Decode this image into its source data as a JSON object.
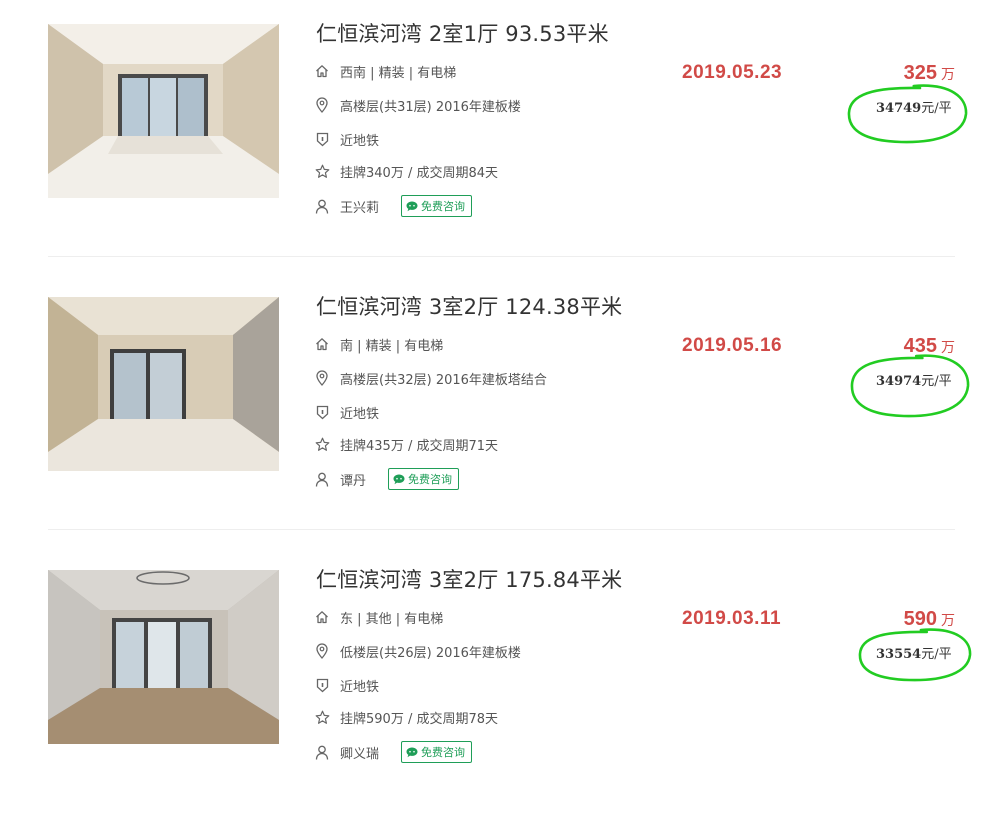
{
  "listings": [
    {
      "title": "仁恒滨河湾 2室1厅 93.53平米",
      "house_info": "西南 | 精装 | 有电梯",
      "position_info": "高楼层(共31层) 2016年建板楼",
      "tag": "近地铁",
      "deal_info": "挂牌340万 / 成交周期84天",
      "agent": "王兴莉",
      "consult_label": "免费咨询",
      "deal_date": "2019.05.23",
      "total_price": "325",
      "price_unit": "万",
      "unit_price": "34749",
      "unit_price_suffix": "元/平"
    },
    {
      "title": "仁恒滨河湾 3室2厅 124.38平米",
      "house_info": "南 | 精装 | 有电梯",
      "position_info": "高楼层(共32层) 2016年建板塔结合",
      "tag": "近地铁",
      "deal_info": "挂牌435万 / 成交周期71天",
      "agent": "谭丹",
      "consult_label": "免费咨询",
      "deal_date": "2019.05.16",
      "total_price": "435",
      "price_unit": "万",
      "unit_price": "34974",
      "unit_price_suffix": "元/平"
    },
    {
      "title": "仁恒滨河湾 3室2厅 175.84平米",
      "house_info": "东 | 其他 | 有电梯",
      "position_info": "低楼层(共26层) 2016年建板楼",
      "tag": "近地铁",
      "deal_info": "挂牌590万 / 成交周期78天",
      "agent": "卿义瑞",
      "consult_label": "免费咨询",
      "deal_date": "2019.03.11",
      "total_price": "590",
      "price_unit": "万",
      "unit_price": "33554",
      "unit_price_suffix": "元/平"
    }
  ],
  "icons": {
    "house_info": "house-icon",
    "position_info": "location-pin-icon",
    "tag": "shield-tag-icon",
    "deal_info": "star-icon",
    "agent": "person-icon",
    "consult": "chat-bubble-icon"
  },
  "colors": {
    "price_red": "#d14a47",
    "consult_green": "#1f9e58",
    "annotation_green": "#22cc22"
  }
}
